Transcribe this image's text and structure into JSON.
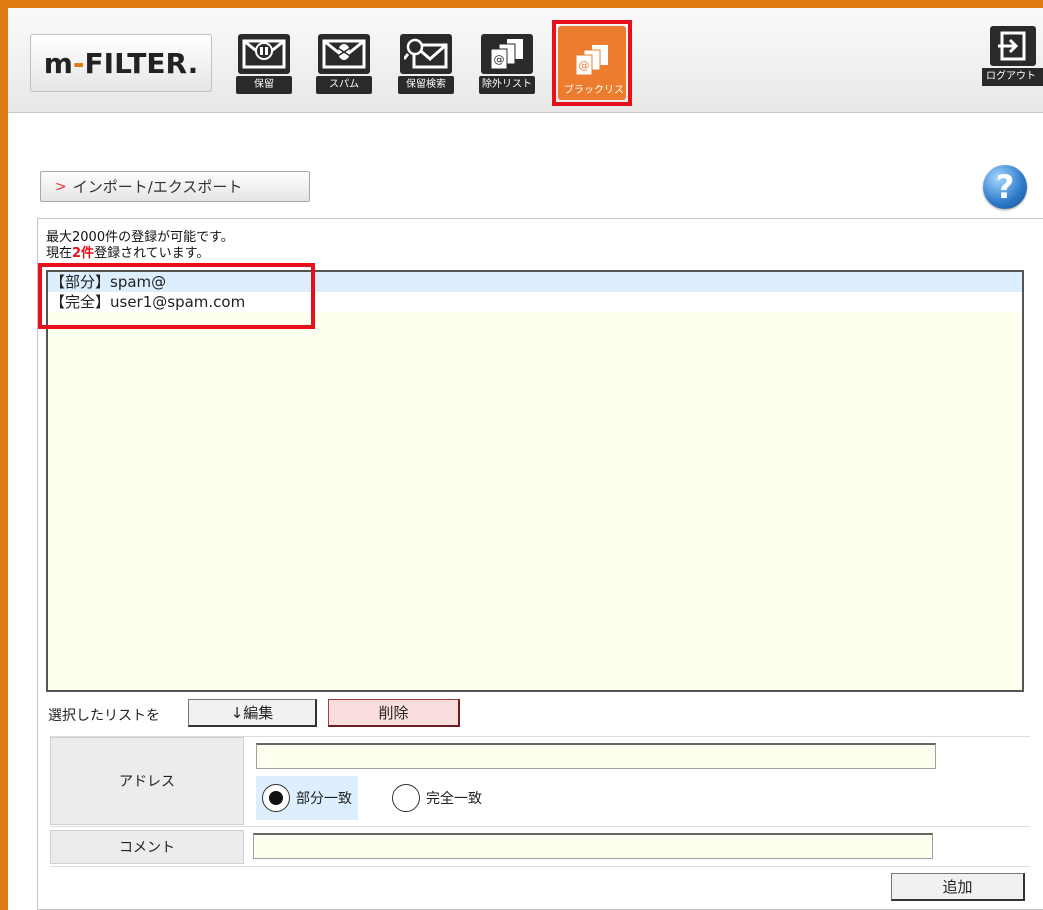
{
  "header": {
    "logo": {
      "prefix": "m",
      "dash": "-",
      "suffix": "FILTER."
    },
    "tools": [
      {
        "label": "保留",
        "icon": "hold-mail-icon"
      },
      {
        "label": "スパム",
        "icon": "spam-mail-icon"
      },
      {
        "label": "保留検索",
        "icon": "hold-search-icon"
      },
      {
        "label": "除外リスト",
        "icon": "exclusion-list-icon"
      },
      {
        "label": "ブラックリスト",
        "icon": "blacklist-icon"
      }
    ],
    "logout_label": "ログアウト"
  },
  "main": {
    "import_export_label": "インポート/エクスポート",
    "help_icon": "?",
    "info_line1": "最大2000件の登録が可能です。",
    "info_line2_prefix": "現在",
    "info_count": "2件",
    "info_line2_suffix": "登録されています。",
    "list_items": [
      "【部分】spam@",
      "【完全】user1@spam.com"
    ],
    "selected_label": "選択したリストを",
    "edit_button": "↓編集",
    "delete_button": "削除",
    "address_label": "アドレス",
    "address_value": "",
    "radio_partial": "部分一致",
    "radio_exact": "完全一致",
    "comment_label": "コメント",
    "comment_value": "",
    "add_button": "追加"
  },
  "colors": {
    "accent": "#e07a12",
    "highlight": "#e8101b",
    "active_tool": "#ec7d2e"
  }
}
